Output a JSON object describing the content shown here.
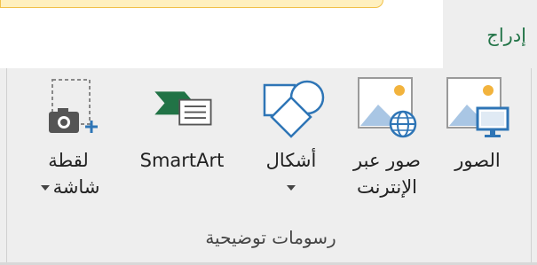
{
  "ribbon_tab": {
    "label": "إدراج"
  },
  "group": {
    "label": "رسومات توضيحية"
  },
  "commands": {
    "pictures": {
      "label": "الصور",
      "icon": "picture-monitor-icon"
    },
    "online_pictures": {
      "label_line1": "صور عبر",
      "label_line2": "الإنترنت",
      "icon": "picture-globe-icon"
    },
    "shapes": {
      "label": "أشكال",
      "icon": "shapes-icon",
      "has_dropdown": true
    },
    "smartart": {
      "label": "SmartArt",
      "icon": "smartart-icon"
    },
    "screenshot": {
      "label_line1": "لقطة",
      "label_line2": "شاشة",
      "icon": "screenshot-camera-icon",
      "has_dropdown": true
    }
  },
  "colors": {
    "accent_green": "#217346",
    "icon_blue": "#2e75b6",
    "icon_green": "#217346",
    "sun_orange": "#f2b33d"
  }
}
